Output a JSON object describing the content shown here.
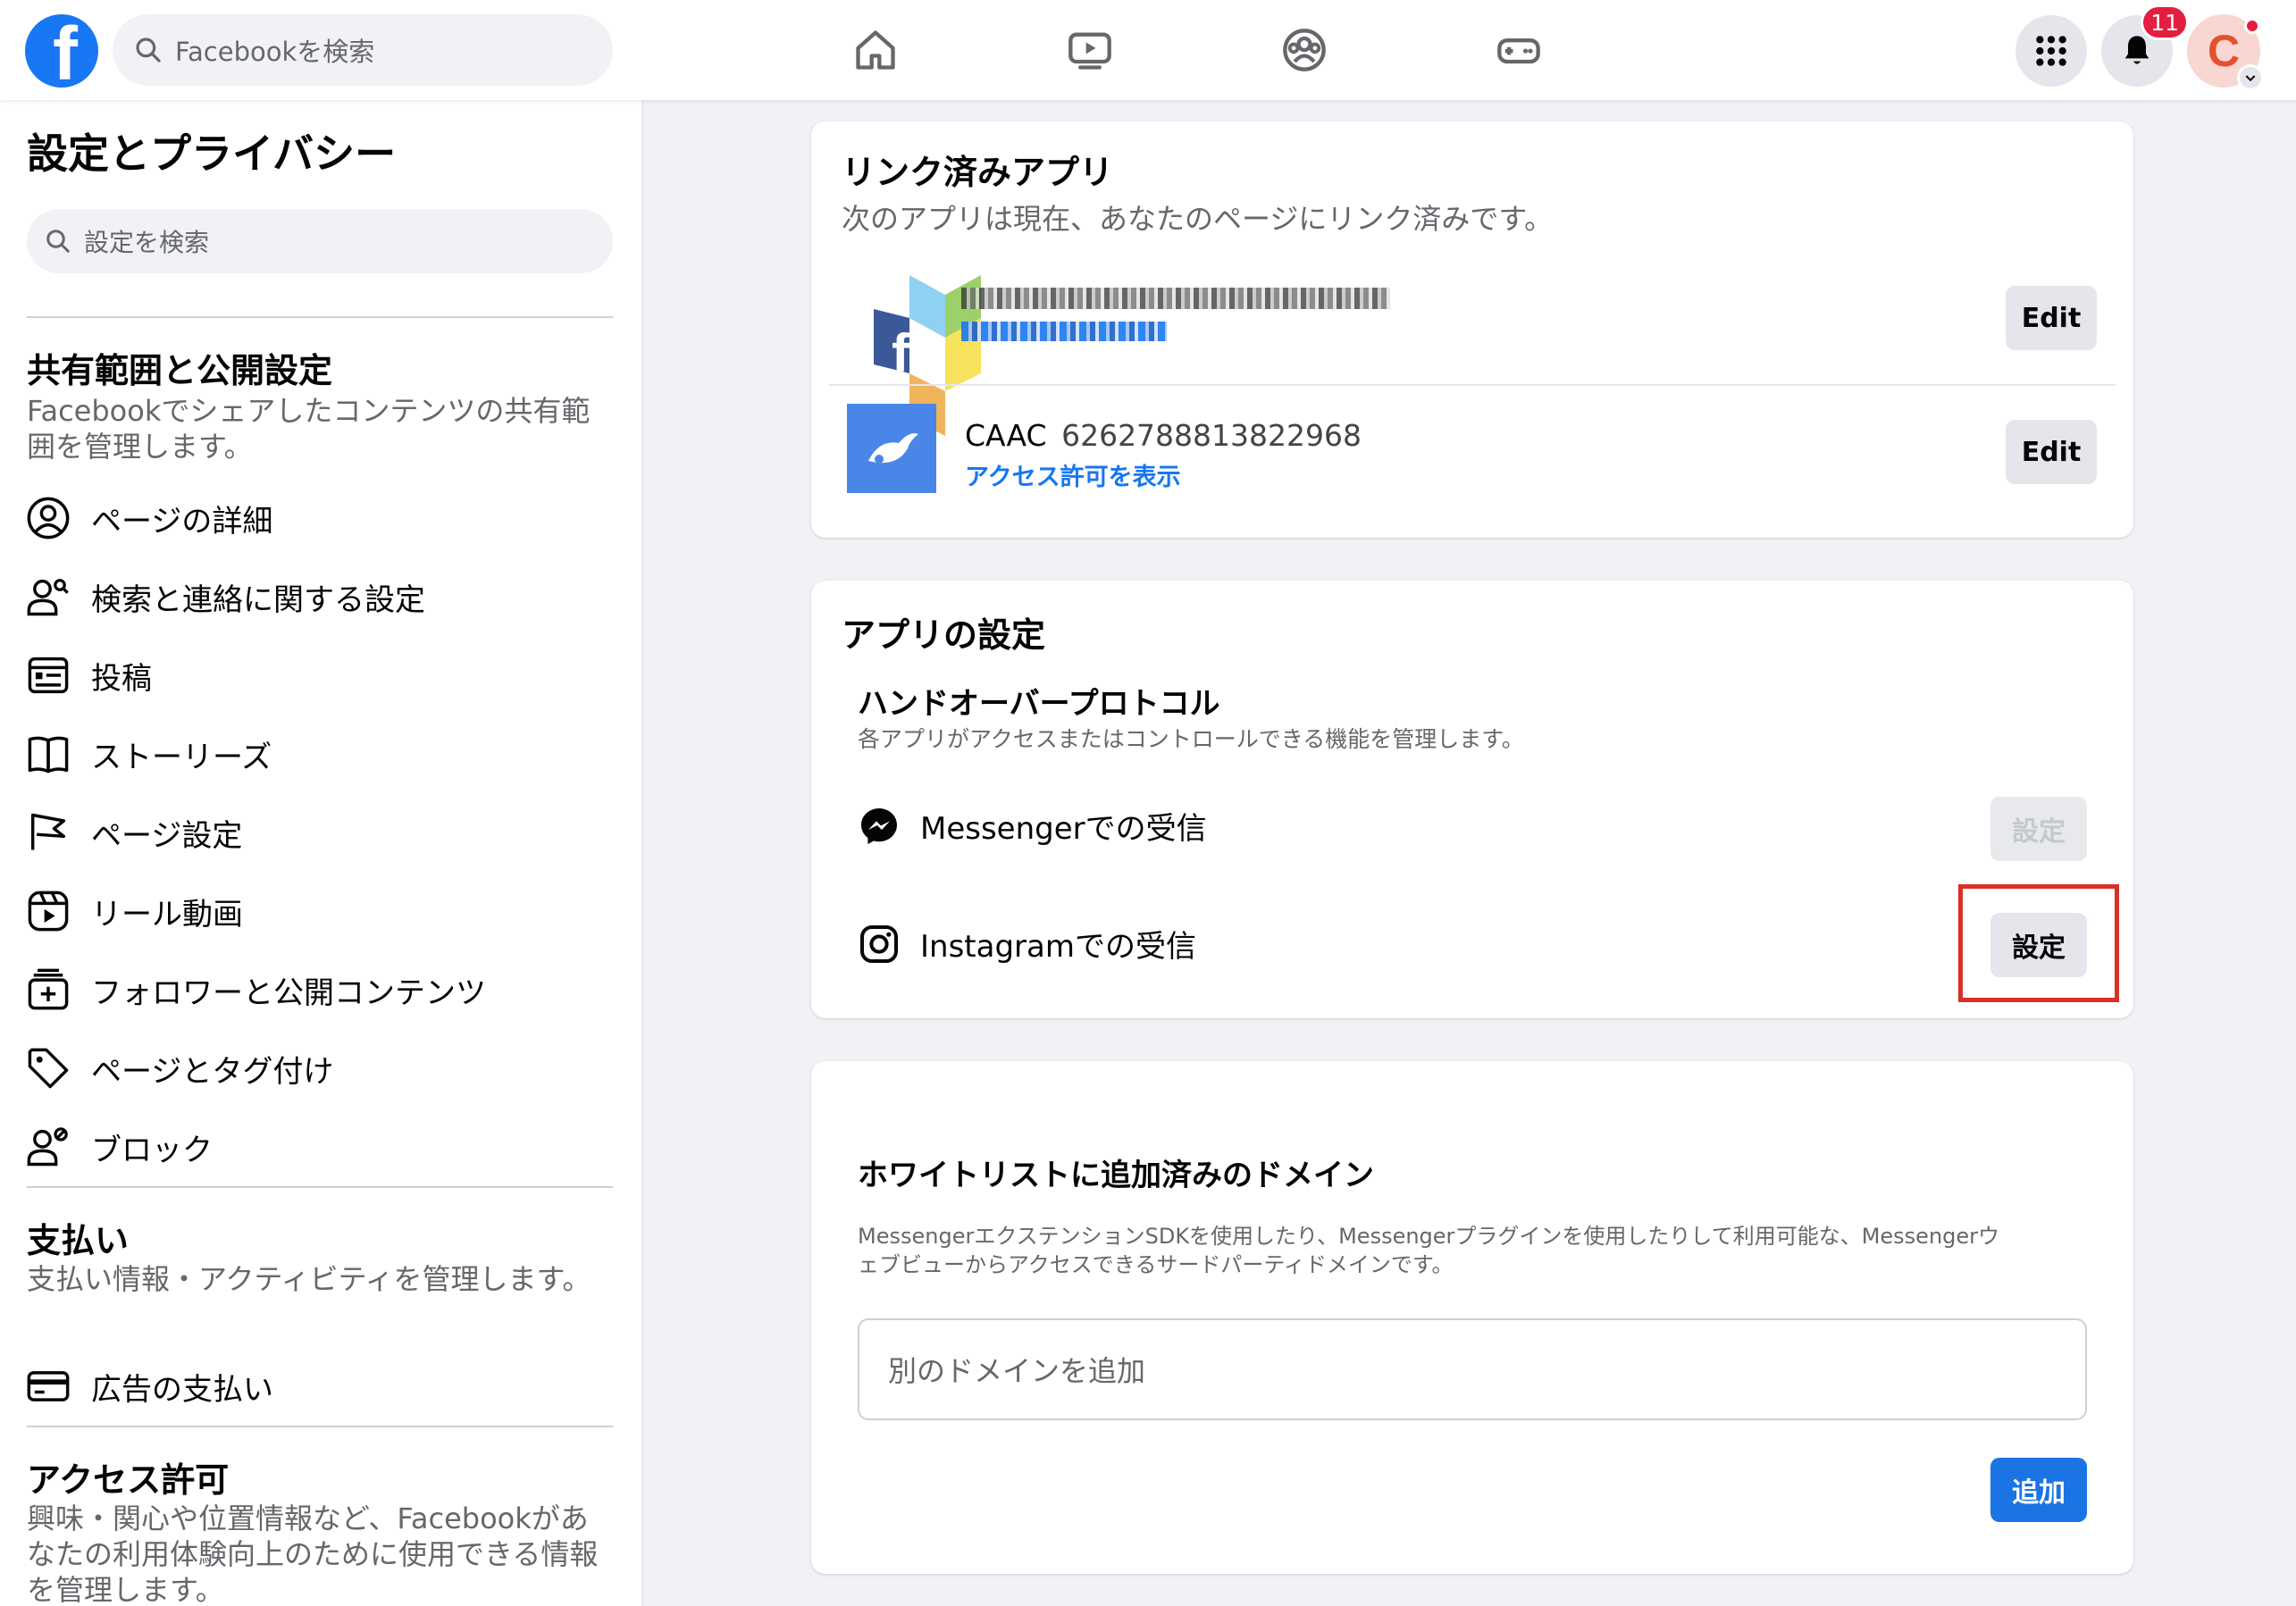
{
  "topbar": {
    "logo_letter": "f",
    "search_placeholder": "Facebookを検索",
    "notification_count": "11",
    "avatar_letter": "C"
  },
  "sidebar": {
    "title": "設定とプライバシー",
    "search_placeholder": "設定を検索",
    "sections": [
      {
        "title": "共有範囲と公開設定",
        "desc": "Facebookでシェアしたコンテンツの共有範囲を管理します。",
        "items": [
          {
            "label": "ページの詳細",
            "icon": "user-circle-icon"
          },
          {
            "label": "検索と連絡に関する設定",
            "icon": "user-search-icon"
          },
          {
            "label": "投稿",
            "icon": "post-icon"
          },
          {
            "label": "ストーリーズ",
            "icon": "book-icon"
          },
          {
            "label": "ページ設定",
            "icon": "flag-icon"
          },
          {
            "label": "リール動画",
            "icon": "reels-icon"
          },
          {
            "label": "フォロワーと公開コンテンツ",
            "icon": "followers-box-icon"
          },
          {
            "label": "ページとタグ付け",
            "icon": "tag-icon"
          },
          {
            "label": "ブロック",
            "icon": "user-block-icon"
          }
        ]
      },
      {
        "title": "支払い",
        "desc": "支払い情報・アクティビティを管理します。",
        "items": [
          {
            "label": "広告の支払い",
            "icon": "credit-card-icon"
          }
        ]
      },
      {
        "title": "アクセス許可",
        "desc": "興味・関心や位置情報など、Facebookがあなたの利用体験向上のために使用できる情報を管理します。"
      }
    ]
  },
  "linked_apps": {
    "title": "リンク済みアプリ",
    "subtitle": "次のアプリは現在、あなたのページにリンク済みです。",
    "apps": [
      {
        "name": "",
        "link": "",
        "edit_label": "Edit"
      },
      {
        "name": "CAAC",
        "id": "6262788813822968",
        "link": "アクセス許可を表示",
        "edit_label": "Edit"
      }
    ]
  },
  "app_settings": {
    "title": "アプリの設定",
    "handover_title": "ハンドオーバープロトコル",
    "handover_desc": "各アプリがアクセスまたはコントロールできる機能を管理します。",
    "rows": [
      {
        "label": "Messengerでの受信",
        "icon": "messenger-icon",
        "button": "設定",
        "enabled": false
      },
      {
        "label": "Instagramでの受信",
        "icon": "instagram-icon",
        "button": "設定",
        "enabled": true
      }
    ]
  },
  "whitelist": {
    "title": "ホワイトリストに追加済みのドメイン",
    "desc_line1": "MessengerエクステンションSDKを使用したり、Messengerプラグインを使用したりして利用可能な、Messengerウ",
    "desc_line2": "ェブビューからアクセスできるサードパーティドメインです。",
    "input_placeholder": "別のドメインを追加",
    "add_label": "追加"
  },
  "colors": {
    "brand_blue": "#1877f2",
    "highlight_red": "#d93025"
  }
}
